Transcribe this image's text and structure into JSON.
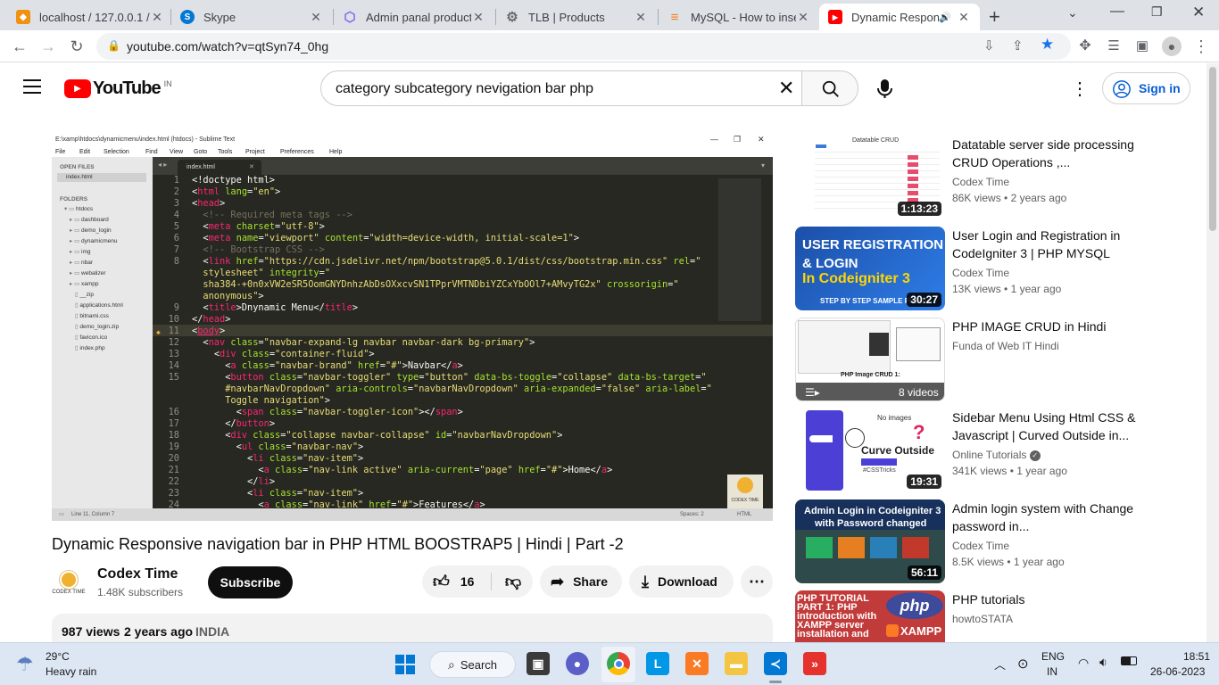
{
  "browser": {
    "tabs": [
      {
        "title": "localhost / 127.0.0.1 /",
        "color": "#f29111",
        "glyph": "pma"
      },
      {
        "title": "Skype",
        "color": "#0078d4",
        "glyph": "S"
      },
      {
        "title": "Admin panal product",
        "color": "#7b68ee",
        "glyph": "⬡"
      },
      {
        "title": "TLB | Products",
        "color": "#6b6b6b",
        "glyph": "⚙"
      },
      {
        "title": "MySQL - How to inser",
        "color": "#f48024",
        "glyph": "≡"
      },
      {
        "title": "Dynamic Respons",
        "color": "#ff0000",
        "glyph": "▶",
        "active": true
      }
    ],
    "url": "youtube.com/watch?v=qtSyn74_0hg"
  },
  "youtube": {
    "logo_text": "YouTube",
    "region": "IN",
    "search_query": "category subcategory nevigation bar php",
    "signin_label": "Sign in"
  },
  "player": {
    "window_title": "E:\\xamp\\htdocs\\dynamicmenu\\index.html (htdocs) - Sublime Text",
    "menu": [
      "File",
      "Edit",
      "Selection",
      "Find",
      "View",
      "Goto",
      "Tools",
      "Project",
      "Preferences",
      "Help"
    ],
    "open_files_header": "OPEN FILES",
    "open_file": "index.html",
    "folders_header": "FOLDERS",
    "folders": [
      "htdocs",
      "dashboard",
      "demo_login",
      "dynamicmenu",
      "img",
      "nbar",
      "webalizer",
      "xampp",
      "__zip",
      "applications.html",
      "bitnami.css",
      "demo_login.zip",
      "favicon.ico",
      "index.php"
    ],
    "tab_name": "index.html",
    "status_left": "Line 11, Column 7",
    "status_spaces": "Spaces: 2",
    "status_syntax": "HTML",
    "watermark": "CODEX TIME",
    "code": [
      {
        "n": "1",
        "html": "<span class='w'>&lt;!doctype html&gt;</span>"
      },
      {
        "n": "2",
        "html": "<span class='w'>&lt;</span><span class='t'>html</span> <span class='a'>lang</span><span class='w'>=</span><span class='s'>\"en\"</span><span class='w'>&gt;</span>"
      },
      {
        "n": "3",
        "html": "<span class='w'>&lt;</span><span class='t'>head</span><span class='w'>&gt;</span>"
      },
      {
        "n": "4",
        "html": "  <span class='c'>&lt;!-- Required meta tags --&gt;</span>"
      },
      {
        "n": "5",
        "html": "  <span class='w'>&lt;</span><span class='t'>meta</span> <span class='a'>charset</span><span class='w'>=</span><span class='s'>\"utf-8\"</span><span class='w'>&gt;</span>"
      },
      {
        "n": "6",
        "html": "  <span class='w'>&lt;</span><span class='t'>meta</span> <span class='a'>name</span><span class='w'>=</span><span class='s'>\"viewport\"</span> <span class='a'>content</span><span class='w'>=</span><span class='s'>\"width=device-width, initial-scale=1\"</span><span class='w'>&gt;</span>"
      },
      {
        "n": "7",
        "html": "  <span class='c'>&lt;!-- Bootstrap CSS --&gt;</span>"
      },
      {
        "n": "8",
        "html": "  <span class='w'>&lt;</span><span class='t'>link</span> <span class='a'>href</span><span class='w'>=</span><span class='s'>\"https://cdn.jsdelivr.net/npm/bootstrap@5.0.1/dist/css/bootstrap.min.css\"</span> <span class='a'>rel</span><span class='w'>=</span><span class='s'>\"</span>"
      },
      {
        "n": "",
        "html": "  <span class='s'>stylesheet\"</span> <span class='a'>integrity</span><span class='w'>=</span><span class='s'>\"</span>"
      },
      {
        "n": "",
        "html": "  <span class='s'>sha384-+0n0xVW2eSR5OomGNYDnhzAbDsOXxcvSN1TPprVMTNDbiYZCxYbOOl7+AMvyTG2x\"</span> <span class='a'>crossorigin</span><span class='w'>=</span><span class='s'>\"</span>"
      },
      {
        "n": "",
        "html": "  <span class='s'>anonymous\"</span><span class='w'>&gt;</span>"
      },
      {
        "n": "9",
        "html": "  <span class='w'>&lt;</span><span class='t'>title</span><span class='w'>&gt;Dnynamic Menu&lt;/</span><span class='t'>title</span><span class='w'>&gt;</span>"
      },
      {
        "n": "10",
        "html": "<span class='w'>&lt;/</span><span class='t'>head</span><span class='w'>&gt;</span>"
      },
      {
        "n": "11",
        "html": "<span class='w'>&lt;</span><span class='t' style='text-decoration:underline'>body</span><span class='w'>&gt;</span>"
      },
      {
        "n": "12",
        "html": "  <span class='w'>&lt;</span><span class='t'>nav</span> <span class='a'>class</span><span class='w'>=</span><span class='s'>\"navbar-expand-lg navbar navbar-dark bg-primary\"</span><span class='w'>&gt;</span>"
      },
      {
        "n": "13",
        "html": "    <span class='w'>&lt;</span><span class='t'>div</span> <span class='a'>class</span><span class='w'>=</span><span class='s'>\"container-fluid\"</span><span class='w'>&gt;</span>"
      },
      {
        "n": "14",
        "html": "      <span class='w'>&lt;</span><span class='t'>a</span> <span class='a'>class</span><span class='w'>=</span><span class='s'>\"navbar-brand\"</span> <span class='a'>href</span><span class='w'>=</span><span class='s'>\"#\"</span><span class='w'>&gt;Navbar&lt;/</span><span class='t'>a</span><span class='w'>&gt;</span>"
      },
      {
        "n": "15",
        "html": "      <span class='w'>&lt;</span><span class='t'>button</span> <span class='a'>class</span><span class='w'>=</span><span class='s'>\"navbar-toggler\"</span> <span class='a'>type</span><span class='w'>=</span><span class='s'>\"button\"</span> <span class='a'>data-bs-toggle</span><span class='w'>=</span><span class='s'>\"collapse\"</span> <span class='a'>data-bs-target</span><span class='w'>=</span><span class='s'>\"</span>"
      },
      {
        "n": "",
        "html": "      <span class='s'>#navbarNavDropdown\"</span> <span class='a'>aria-controls</span><span class='w'>=</span><span class='s'>\"navbarNavDropdown\"</span> <span class='a'>aria-expanded</span><span class='w'>=</span><span class='s'>\"false\"</span> <span class='a'>aria-label</span><span class='w'>=</span><span class='s'>\"</span>"
      },
      {
        "n": "",
        "html": "      <span class='s'>Toggle navigation\"</span><span class='w'>&gt;</span>"
      },
      {
        "n": "16",
        "html": "        <span class='w'>&lt;</span><span class='t'>span</span> <span class='a'>class</span><span class='w'>=</span><span class='s'>\"navbar-toggler-icon\"</span><span class='w'>&gt;&lt;/</span><span class='t'>span</span><span class='w'>&gt;</span>"
      },
      {
        "n": "17",
        "html": "      <span class='w'>&lt;/</span><span class='t'>button</span><span class='w'>&gt;</span>"
      },
      {
        "n": "18",
        "html": "      <span class='w'>&lt;</span><span class='t'>div</span> <span class='a'>class</span><span class='w'>=</span><span class='s'>\"collapse navbar-collapse\"</span> <span class='a'>id</span><span class='w'>=</span><span class='s'>\"navbarNavDropdown\"</span><span class='w'>&gt;</span>"
      },
      {
        "n": "19",
        "html": "        <span class='w'>&lt;</span><span class='t'>ul</span> <span class='a'>class</span><span class='w'>=</span><span class='s'>\"navbar-nav\"</span><span class='w'>&gt;</span>"
      },
      {
        "n": "20",
        "html": "          <span class='w'>&lt;</span><span class='t'>li</span> <span class='a'>class</span><span class='w'>=</span><span class='s'>\"nav-item\"</span><span class='w'>&gt;</span>"
      },
      {
        "n": "21",
        "html": "            <span class='w'>&lt;</span><span class='t'>a</span> <span class='a'>class</span><span class='w'>=</span><span class='s'>\"nav-link active\"</span> <span class='a'>aria-current</span><span class='w'>=</span><span class='s'>\"page\"</span> <span class='a'>href</span><span class='w'>=</span><span class='s'>\"#\"</span><span class='w'>&gt;Home&lt;/</span><span class='t'>a</span><span class='w'>&gt;</span>"
      },
      {
        "n": "22",
        "html": "          <span class='w'>&lt;/</span><span class='t'>li</span><span class='w'>&gt;</span>"
      },
      {
        "n": "23",
        "html": "          <span class='w'>&lt;</span><span class='t'>li</span> <span class='a'>class</span><span class='w'>=</span><span class='s'>\"nav-item\"</span><span class='w'>&gt;</span>"
      },
      {
        "n": "24",
        "html": "            <span class='w'>&lt;</span><span class='t'>a</span> <span class='a'>class</span><span class='w'>=</span><span class='s'>\"nav-link\"</span> <span class='a'>href</span><span class='w'>=</span><span class='s'>\"#\"</span><span class='w'>&gt;Features&lt;/</span><span class='t'>a</span><span class='w'>&gt;</span>"
      }
    ]
  },
  "video": {
    "title": "Dynamic Responsive navigation bar in PHP HTML BOOSTRAP5 | Hindi | Part -2",
    "channel": "Codex Time",
    "channel_avatar_text": "CODEX TIME",
    "subscribers": "1.48K subscribers",
    "subscribe_label": "Subscribe",
    "likes": "16",
    "share_label": "Share",
    "download_label": "Download",
    "views": "987 views",
    "age": "2 years ago",
    "location": "INDIA"
  },
  "recommendations": [
    {
      "title": "Datatable server side processing CRUD Operations ,...",
      "channel": "Codex Time",
      "views": "86K views",
      "age": "2 years ago",
      "duration": "1:13:23",
      "thumb_text": "Datatable CRUD",
      "verified": false
    },
    {
      "title": "User Login and Registration in CodeIgniter 3 | PHP MYSQL",
      "channel": "Codex Time",
      "views": "13K views",
      "age": "1 year ago",
      "duration": "30:27",
      "thumb_text": "USER REGISTRATION & LOGIN",
      "thumb_text2": "In Codeigniter 3",
      "thumb_text3": "STEP BY STEP SAMPLE PROJE",
      "verified": false
    },
    {
      "title": "PHP IMAGE CRUD in Hindi",
      "channel": "Funda of Web IT Hindi",
      "views": "",
      "age": "",
      "duration": "8 videos",
      "thumb_text": "PHP Image CRUD 1:",
      "verified": false
    },
    {
      "title": "Sidebar Menu Using Html CSS & Javascript | Curved Outside in...",
      "channel": "Online Tutorials",
      "views": "341K views",
      "age": "1 year ago",
      "duration": "19:31",
      "thumb_text": "Curve Outside",
      "thumb_text2": "No images",
      "thumb_text3": "#CSSTricks",
      "verified": true
    },
    {
      "title": "Admin login system with Change password in...",
      "channel": "Codex Time",
      "views": "8.5K views",
      "age": "1 year ago",
      "duration": "56:11",
      "thumb_text": "Admin Login in Codeigniter 3",
      "thumb_text2": "with Password changed",
      "verified": false
    },
    {
      "title": "PHP tutorials",
      "channel": "howtoSTATA",
      "views": "",
      "age": "",
      "duration": "",
      "thumb_text": "PHP TUTORIAL PART 1: PHP introduction with XAMPP server installation and",
      "thumb_text2": "php",
      "thumb_text3": "XAMPP",
      "verified": false
    }
  ],
  "taskbar": {
    "weather_temp": "29°C",
    "weather_desc": "Heavy rain",
    "search_label": "Search",
    "lang1": "ENG",
    "lang2": "IN",
    "time": "18:51",
    "date": "26-06-2023"
  }
}
